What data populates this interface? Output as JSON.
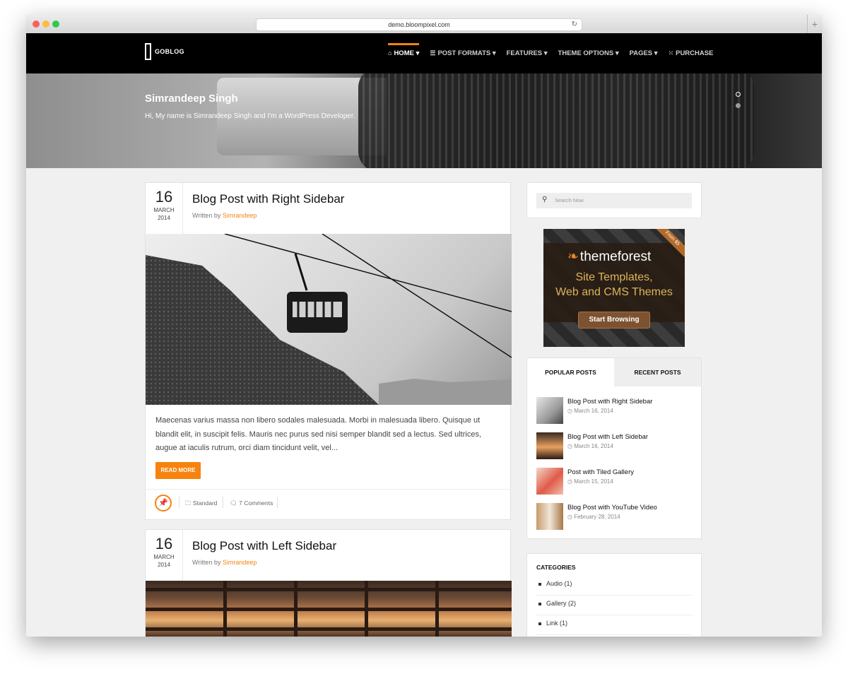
{
  "browser": {
    "url": "demo.bloompixel.com"
  },
  "site": {
    "logo": "GOBLOG"
  },
  "nav": {
    "items": [
      {
        "label": "HOME ▾",
        "icon": "⌂"
      },
      {
        "label": "POST FORMATS ▾",
        "icon": "☰"
      },
      {
        "label": "FEATURES ▾"
      },
      {
        "label": "THEME OPTIONS ▾"
      },
      {
        "label": "PAGES ▾"
      },
      {
        "label": "PURCHASE",
        "icon": "⁙"
      }
    ]
  },
  "hero": {
    "title": "Simrandeep Singh",
    "subtitle": "Hi, My name is Simrandeep Singh and I'm a WordPress Developer."
  },
  "posts": [
    {
      "day": "16",
      "month": "MARCH",
      "year": "2014",
      "title": "Blog Post with Right Sidebar",
      "written_prefix": "Written by",
      "author": "Simrandeep",
      "excerpt": "Maecenas varius massa non libero sodales malesuada. Morbi in malesuada libero. Quisque ut blandit elit, in suscipit felis. Mauris nec purus sed nisi semper blandit sed a lectus. Sed ultrices, augue at iaculis rutrum, orci diam tincidunt velit, vel...",
      "read_more": "READ MORE",
      "category": "Standard",
      "comments": "7 Comments"
    },
    {
      "day": "16",
      "month": "MARCH",
      "year": "2014",
      "title": "Blog Post with Left Sidebar",
      "written_prefix": "Written by",
      "author": "Simrandeep"
    }
  ],
  "sidebar": {
    "search_placeholder": "Search Now",
    "ad": {
      "brand": "themeforest",
      "line1": "Site Templates,",
      "line2": "Web and CMS Themes",
      "button": "Start Browsing",
      "ribbon": "From $5"
    },
    "tabs": [
      "POPULAR POSTS",
      "RECENT POSTS"
    ],
    "popular": [
      {
        "title": "Blog Post with Right Sidebar",
        "date": "March 16, 2014"
      },
      {
        "title": "Blog Post with Left Sidebar",
        "date": "March 16, 2014"
      },
      {
        "title": "Post with Tiled Gallery",
        "date": "March 15, 2014"
      },
      {
        "title": "Blog Post with YouTube Video",
        "date": "February 28, 2014"
      }
    ],
    "categories_title": "CATEGORIES",
    "categories": [
      {
        "label": "Audio (1)"
      },
      {
        "label": "Gallery (2)"
      },
      {
        "label": "Link (1)"
      }
    ]
  },
  "colors": {
    "accent": "#f7820e",
    "nav_bg": "#000000",
    "page_bg": "#f0f0f0"
  }
}
